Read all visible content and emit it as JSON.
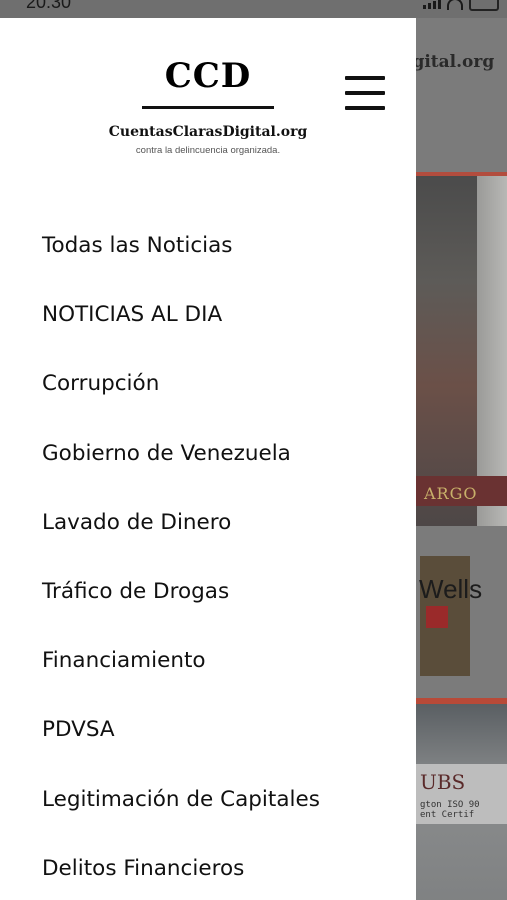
{
  "status_bar": {
    "time": "20:30",
    "icons": [
      "signal-icon",
      "wifi-icon",
      "battery-icon"
    ]
  },
  "drawer": {
    "logo": {
      "title": "CCD",
      "site": "CuentasClarasDigital.org",
      "tagline": "contra la delincuencia organizada."
    },
    "menu_icon": "hamburger-menu-icon",
    "items": [
      {
        "label": "Todas las Noticias"
      },
      {
        "label": "NOTICIAS AL DIA"
      },
      {
        "label": "Corrupción"
      },
      {
        "label": "Gobierno de Venezuela"
      },
      {
        "label": "Lavado de Dinero"
      },
      {
        "label": "Tráfico de Drogas"
      },
      {
        "label": "Financiamiento"
      },
      {
        "label": "PDVSA"
      },
      {
        "label": "Legitimación de Capitales"
      },
      {
        "label": "Delitos Financieros"
      }
    ]
  },
  "background": {
    "site_name_fragment": "igital.org",
    "headline_fragment": "Wells",
    "image1_text": "ARGO",
    "image2_text": "UBS",
    "image2_subtext": "gton  ISO 90\nent   Certif"
  },
  "colors": {
    "overlay": "#7b7b7b",
    "drawer_bg": "#ffffff",
    "text": "#111111",
    "accent_border": "#b84a38"
  }
}
